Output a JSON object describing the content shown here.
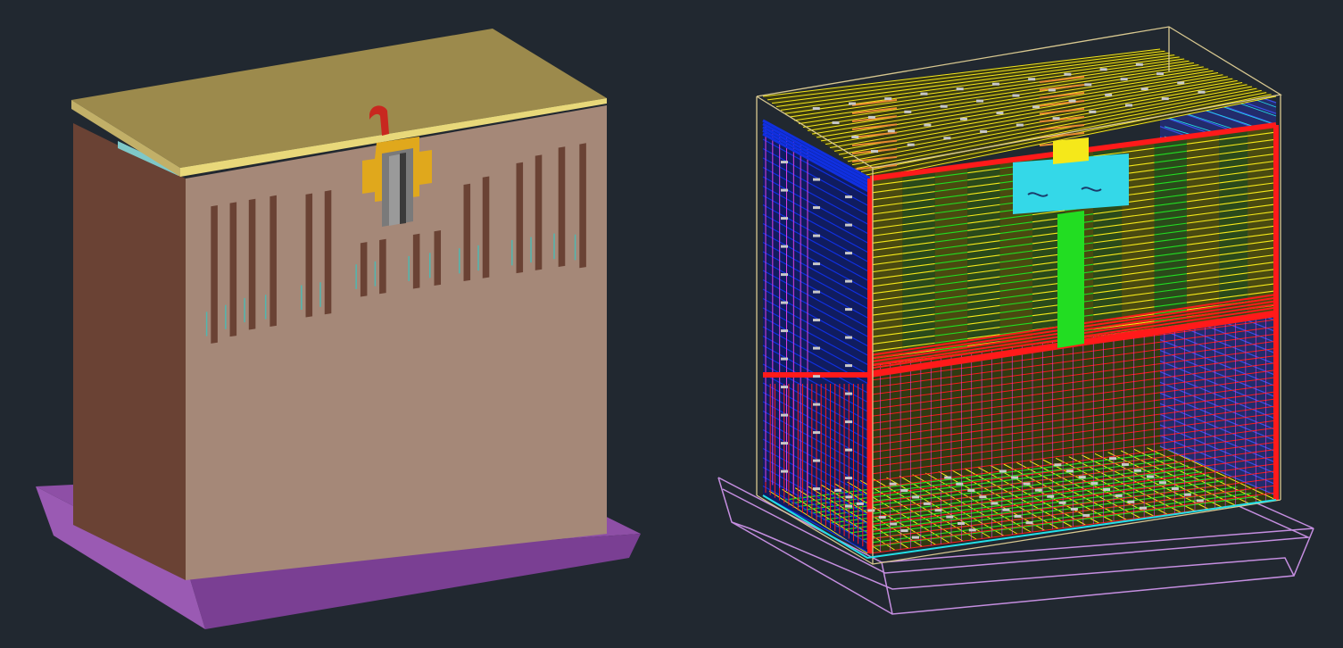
{
  "viewport": {
    "background": "#212830"
  },
  "solid_model": {
    "colors": {
      "base_top": "#8e4fa6",
      "base_front": "#7a3f93",
      "base_left": "#9a5ab3",
      "body_front": "#a58878",
      "body_side": "#6a4234",
      "top_lid": "#9c8a4c",
      "lid_edge": "#e8d87a",
      "slot": "#6a4234",
      "slot_tick": "#4fb7b0",
      "bracket": "#e0a81c",
      "bracket_inner": "#8a8a8a",
      "handle": "#c8281f",
      "gasket": "#7fc8c8"
    }
  },
  "wireframe_model": {
    "colors": {
      "bounding_box": "#d8c890",
      "base_outline": "#c58ee0",
      "left_panel": "#1030e0",
      "red": "#ff1a1a",
      "yellow": "#f5e81a",
      "green": "#22dd22",
      "cyan": "#22e0e8",
      "magenta": "#e040e0",
      "blue_right": "#3a50e8",
      "orange": "#e88a30",
      "label_box": "#34d8e8",
      "white_dots": "#c8c8c8"
    }
  }
}
